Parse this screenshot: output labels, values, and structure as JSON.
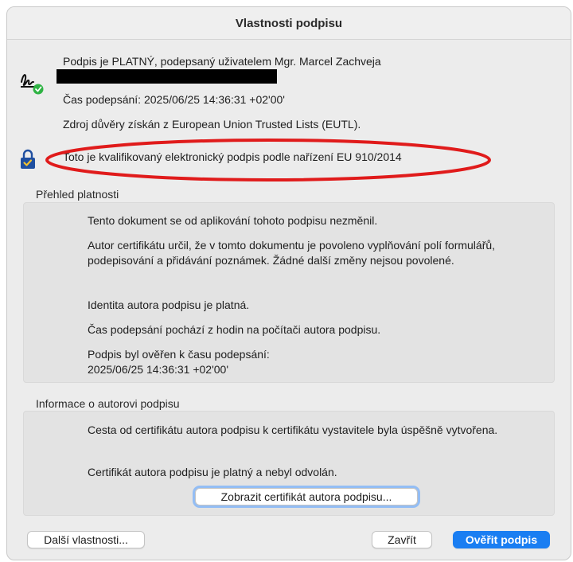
{
  "window": {
    "title": "Vlastnosti podpisu"
  },
  "header": {
    "status_line": "Podpis je PLATNÝ, podepsaný uživatelem Mgr. Marcel Zachveja",
    "signing_time": "Čas podepsání:  2025/06/25 14:36:31 +02'00'",
    "trust_source": "Zdroj důvěry získán z European Union Trusted Lists (EUTL).",
    "qualified_note": "Toto je kvalifikovaný elektronický podpis podle nařízení EU 910/2014",
    "annotation_color": "#e01b1b"
  },
  "validity": {
    "label": "Přehled platnosti",
    "items": [
      "Tento dokument se od aplikování tohoto podpisu nezměnil.",
      "Autor certifikátu určil, že v tomto dokumentu je povoleno vyplňování polí formulářů, podepisování a přidávání poznámek. Žádné další změny nejsou povolené.",
      "Identita autora podpisu je platná.",
      "Čas podepsání pochází z hodin na počítači autora podpisu.",
      "Podpis byl ověřen k času podepsání:\n2025/06/25 14:36:31 +02'00'"
    ]
  },
  "signer_info": {
    "label": "Informace o autorovi podpisu",
    "items": [
      "Cesta od certifikátu autora podpisu k certifikátu vystavitele byla úspěšně vytvořena.",
      "Certifikát autora podpisu je platný a nebyl odvolán."
    ],
    "show_cert_button": "Zobrazit certifikát autora podpisu..."
  },
  "footer": {
    "more_button": "Další vlastnosti...",
    "close_button": "Zavřít",
    "verify_button": "Ověřit podpis"
  },
  "colors": {
    "accent": "#1a7ef2",
    "success": "#2fb344",
    "lock": "#1f4fa0"
  },
  "icons": {
    "signature": "signature-valid-icon",
    "lock": "lock-icon"
  }
}
